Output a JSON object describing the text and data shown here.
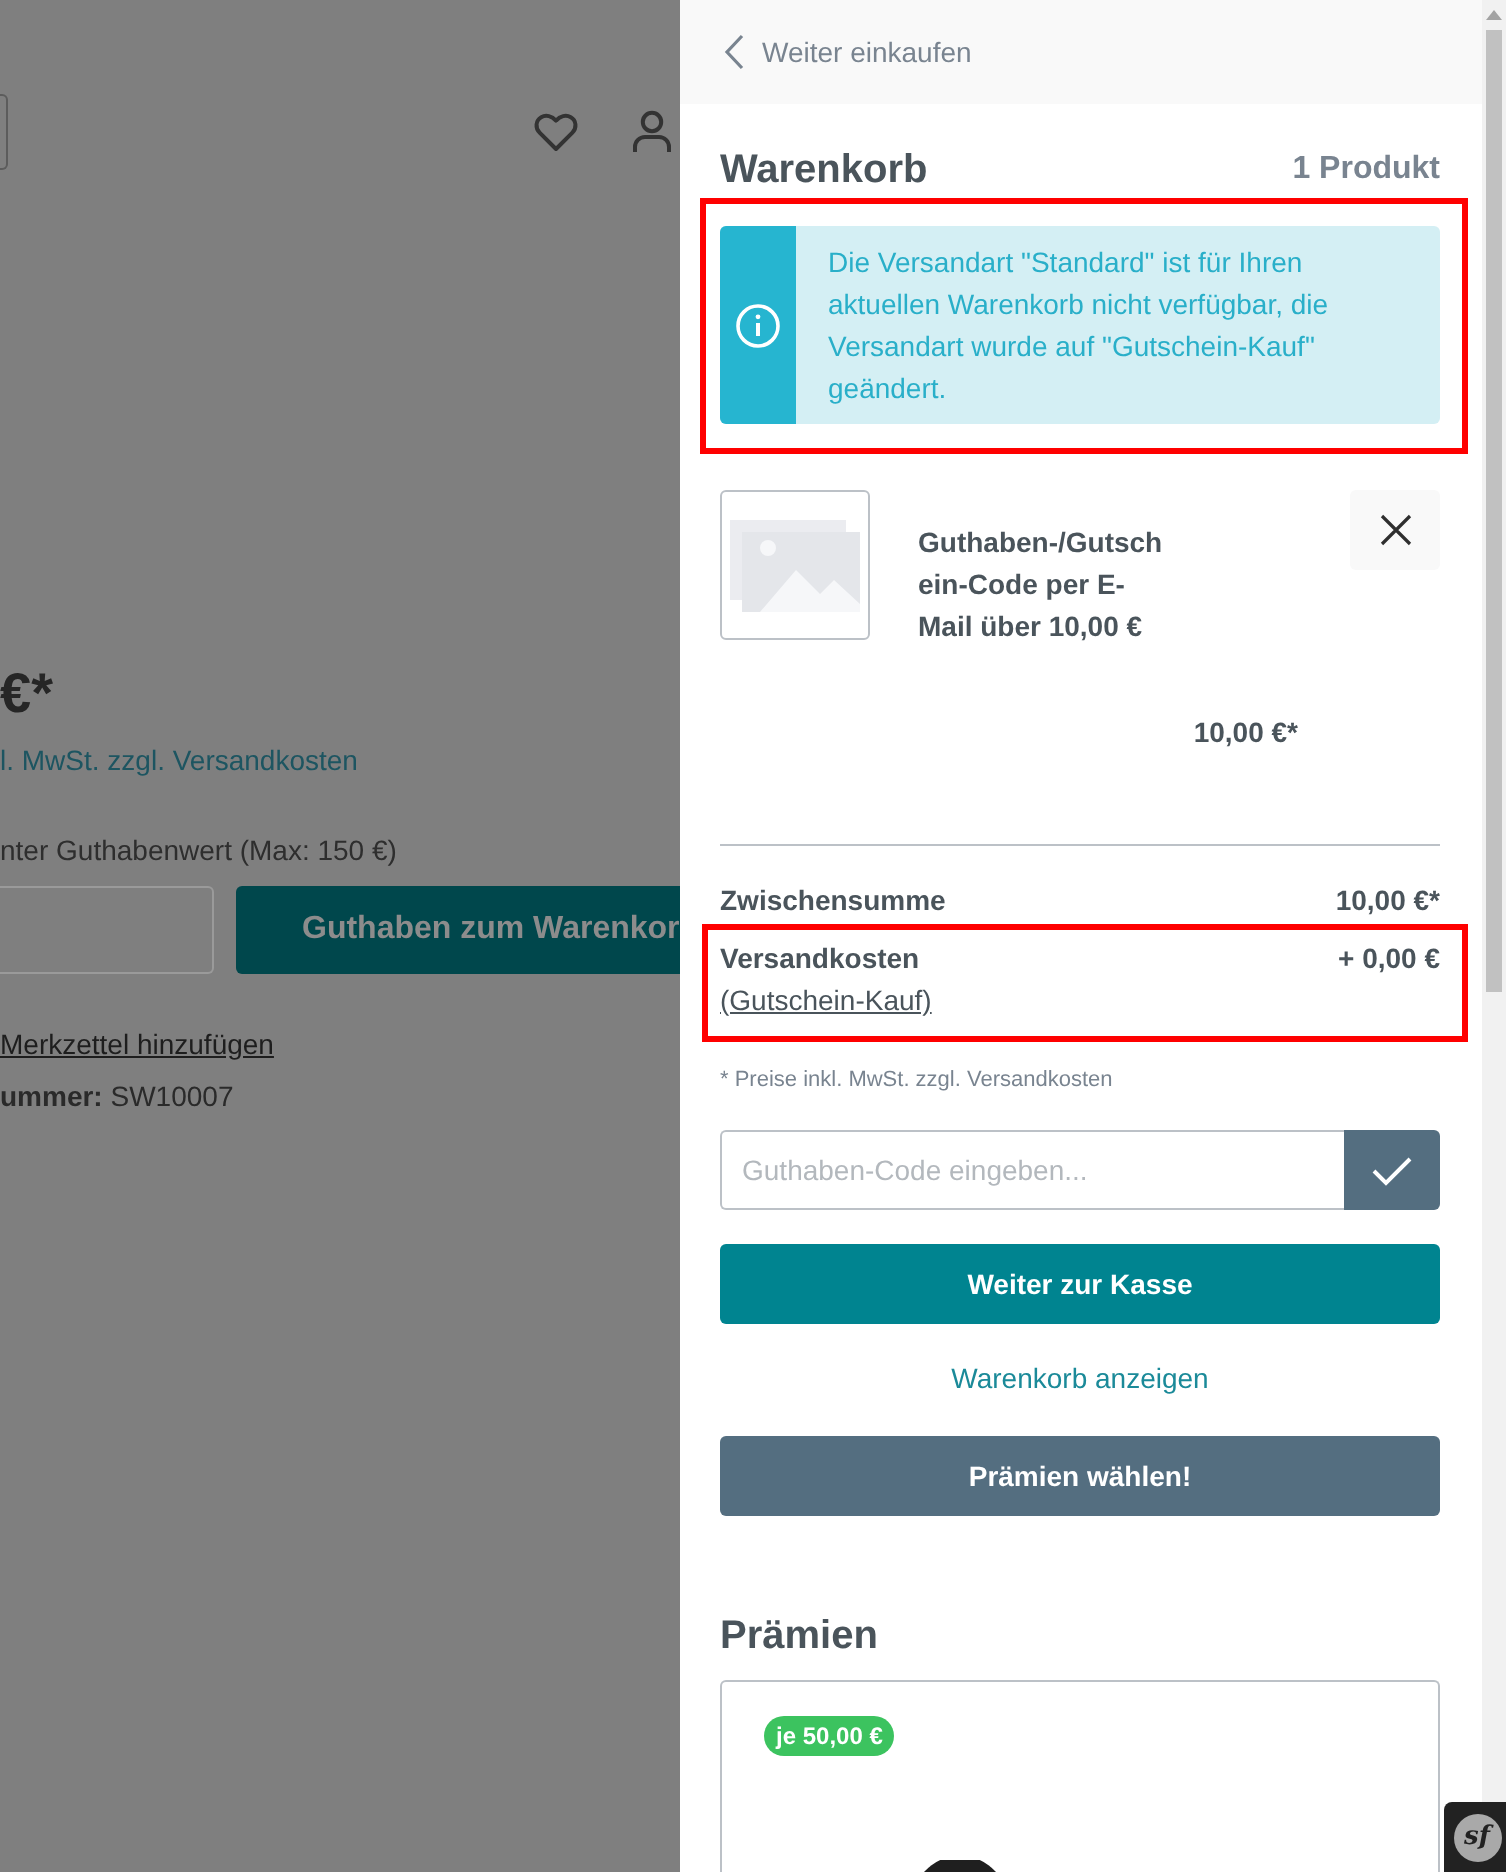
{
  "background_page": {
    "price": "€*",
    "tax_note": "l. MwSt. zzgl. Versandkosten",
    "amount_label": "nter Guthabenwert (Max: 150 €)",
    "add_button": "Guthaben zum Warenkor",
    "wishlist_link": "Merkzettel hinzufügen",
    "product_number": {
      "label": "ummer:",
      "value": "SW10007"
    }
  },
  "cart": {
    "back_link": "Weiter einkaufen",
    "title": "Warenkorb",
    "item_count": "1 Produkt",
    "alert": {
      "kind": "info",
      "text": "Die Versandart \"Standard\" ist für Ihren aktuellen Warenkorb nicht verfügbar, die Versandart wurde auf \"Gutschein-Kauf\" geändert.",
      "highlighted": true
    },
    "items": [
      {
        "name": "Guthaben-/Gutschein-Code per E-Mail über 10,00 €",
        "price": "10,00 €*"
      }
    ],
    "summary": [
      {
        "label": "Zwischensumme",
        "value": "10,00 €*",
        "highlighted": false
      },
      {
        "label": "Versandkosten",
        "link": "(Gutschein-Kauf)",
        "value": "+ 0,00 €",
        "highlighted": true
      }
    ],
    "tax_note": "* Preise inkl. MwSt. zzgl. Versandkosten",
    "voucher": {
      "placeholder": "Guthaben-Code eingeben..."
    },
    "checkout_button": "Weiter zur Kasse",
    "view_cart_link": "Warenkorb anzeigen",
    "rewards_button": "Prämien wählen!"
  },
  "rewards": {
    "title": "Prämien",
    "items": [
      {
        "badge": "je 50,00 €"
      }
    ]
  },
  "debug_toolbar": {
    "logo": "sf"
  }
}
